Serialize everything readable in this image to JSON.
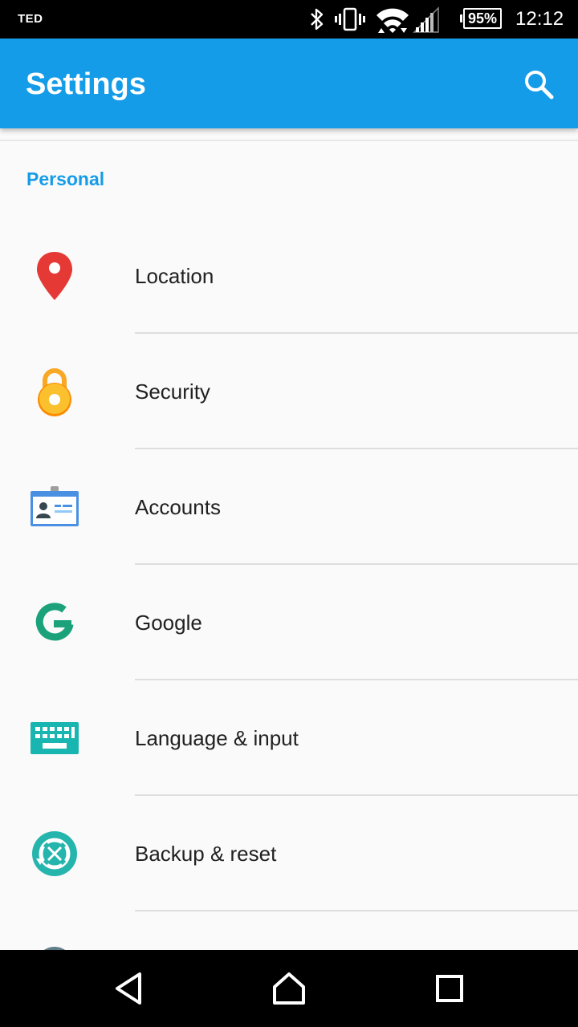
{
  "status_bar": {
    "carrier": "TED",
    "battery": "95%",
    "time": "12:12",
    "icons": [
      "bluetooth-icon",
      "vibrate-icon",
      "wifi-icon",
      "cell-signal-icon",
      "battery-icon"
    ]
  },
  "app_bar": {
    "title": "Settings",
    "search_icon": "search-icon"
  },
  "section": {
    "title": "Personal"
  },
  "items": [
    {
      "label": "Location",
      "icon": "location-pin-icon",
      "color": "#e53935"
    },
    {
      "label": "Security",
      "icon": "padlock-icon",
      "color": "#f9a825"
    },
    {
      "label": "Accounts",
      "icon": "id-badge-icon",
      "color": "#4a90e2"
    },
    {
      "label": "Google",
      "icon": "google-g-icon",
      "color": "#1ba27a"
    },
    {
      "label": "Language & input",
      "icon": "keyboard-icon",
      "color": "#19b5b0"
    },
    {
      "label": "Backup & reset",
      "icon": "backup-reset-icon",
      "color": "#26b5ad"
    }
  ],
  "colors": {
    "accent": "#159ce8",
    "background": "#fafafa",
    "text": "#212121"
  },
  "nav_bar": {
    "icons": [
      "back-icon",
      "home-icon",
      "recents-icon"
    ]
  }
}
